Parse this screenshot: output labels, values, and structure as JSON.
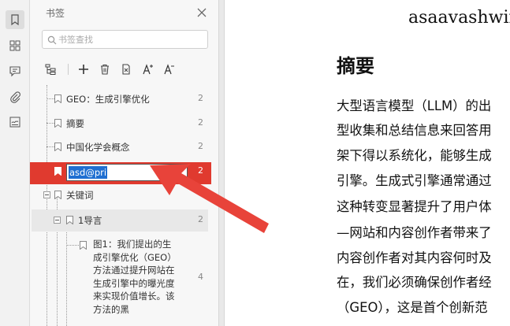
{
  "rail": {
    "icons": [
      "bookmark-icon",
      "thumbnails-icon",
      "comment-icon",
      "attachment-icon",
      "signature-icon"
    ]
  },
  "bookmarks_panel": {
    "title": "书签",
    "search_placeholder": "书签查找",
    "toolbar": [
      "collapse-all-icon",
      "add-icon",
      "delete-icon",
      "delete-other-icon",
      "font-increase-icon",
      "font-decrease-icon"
    ],
    "items": [
      {
        "label": "GEO：生成引擎优化",
        "page": "2"
      },
      {
        "label": "摘要",
        "page": "2"
      },
      {
        "label": "中国化学会概念",
        "page": "2"
      },
      {
        "label": "asd@pri",
        "page": "2",
        "editing": true
      },
      {
        "label": "关键词",
        "page": ""
      },
      {
        "label": "1导言",
        "page": "2"
      },
      {
        "label": "图1：我们提出的生成引擎优化（GEO）方法通过提升网站在生成引擎中的曝光度来实现价值增长。该方法的黑",
        "page": "4"
      }
    ],
    "multi_lines": [
      "图1：我们提出的生",
      "成引擎优化（GEO）",
      "方法通过提升网站在",
      "生成引擎中的曝光度",
      "来实现价值增长。该",
      "方法的黑"
    ]
  },
  "document": {
    "header": "asaavashwin",
    "heading": "摘要",
    "lines": [
      "大型语言模型（LLM）的出",
      "型收集和总结信息来回答用",
      "架下得以系统化，能够生成",
      "引擎。生成式引擎通常通过",
      "这种转变显著提升了用户体",
      "—网站和内容创作者带来了",
      "内容创作者对其内容何时及",
      "在，我们必须确保创作者经",
      "（GEO），这是首个创新范"
    ]
  },
  "colors": {
    "accent_red": "#e03a2f",
    "selection_blue": "#1f6fd1",
    "arrow_red": "#e8433a"
  }
}
